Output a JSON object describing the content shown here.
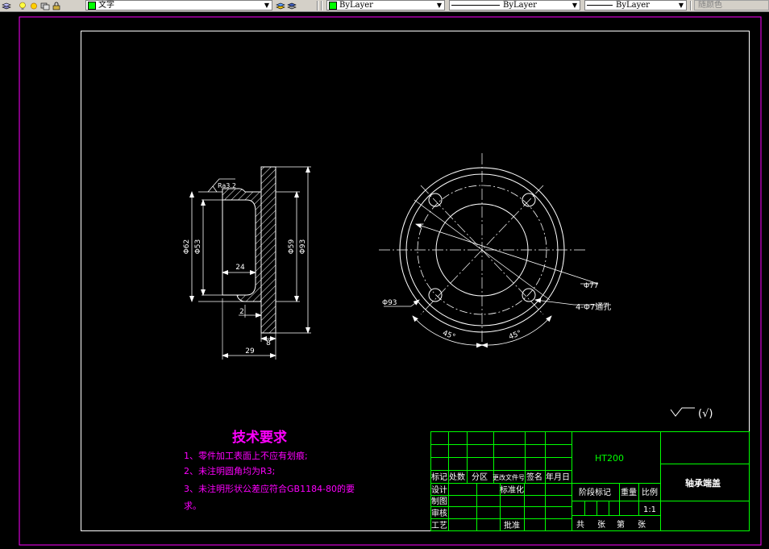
{
  "toolbar": {
    "layer_name": "文字",
    "color_control": "ByLayer",
    "linetype_control": "ByLayer",
    "lineweight_control": "ByLayer",
    "plotstyle_control": "随颜色"
  },
  "drawing": {
    "roughness_symbol": "Ra3.2",
    "section_dims": {
      "d62": "Φ62",
      "d53": "Φ53",
      "d59": "Φ59",
      "d93": "Φ93",
      "depth_24": "24",
      "step_2": "2",
      "flange_8": "8",
      "length_29": "29"
    },
    "plan_dims": {
      "d93": "Φ93",
      "d77": "Φ77",
      "holes": "4-Φ7通孔",
      "angle_left": "45°",
      "angle_right": "45°"
    },
    "surface_symbol": "(√)",
    "tech": {
      "title": "技术要求",
      "items": [
        "1、零件加工表面上不应有划痕;",
        "2、未注明圆角均为R3;",
        "3、未注明形状公差应符合GB1184-80的要",
        "求。"
      ]
    },
    "title_block": {
      "material": "HT200",
      "part_name": "轴承端盖",
      "header": [
        "标记",
        "处数",
        "分区",
        "更改文件号",
        "签名",
        "年月日"
      ],
      "left_labels": [
        "设计",
        "制图",
        "审核",
        "工艺"
      ],
      "standardize": "标准化",
      "approve": "批准",
      "stage_mark": "阶段标记",
      "weight": "重量",
      "scale_label": "比例",
      "scale_value": "1:1",
      "sheets": [
        "共",
        "张",
        "第",
        "张"
      ]
    }
  }
}
